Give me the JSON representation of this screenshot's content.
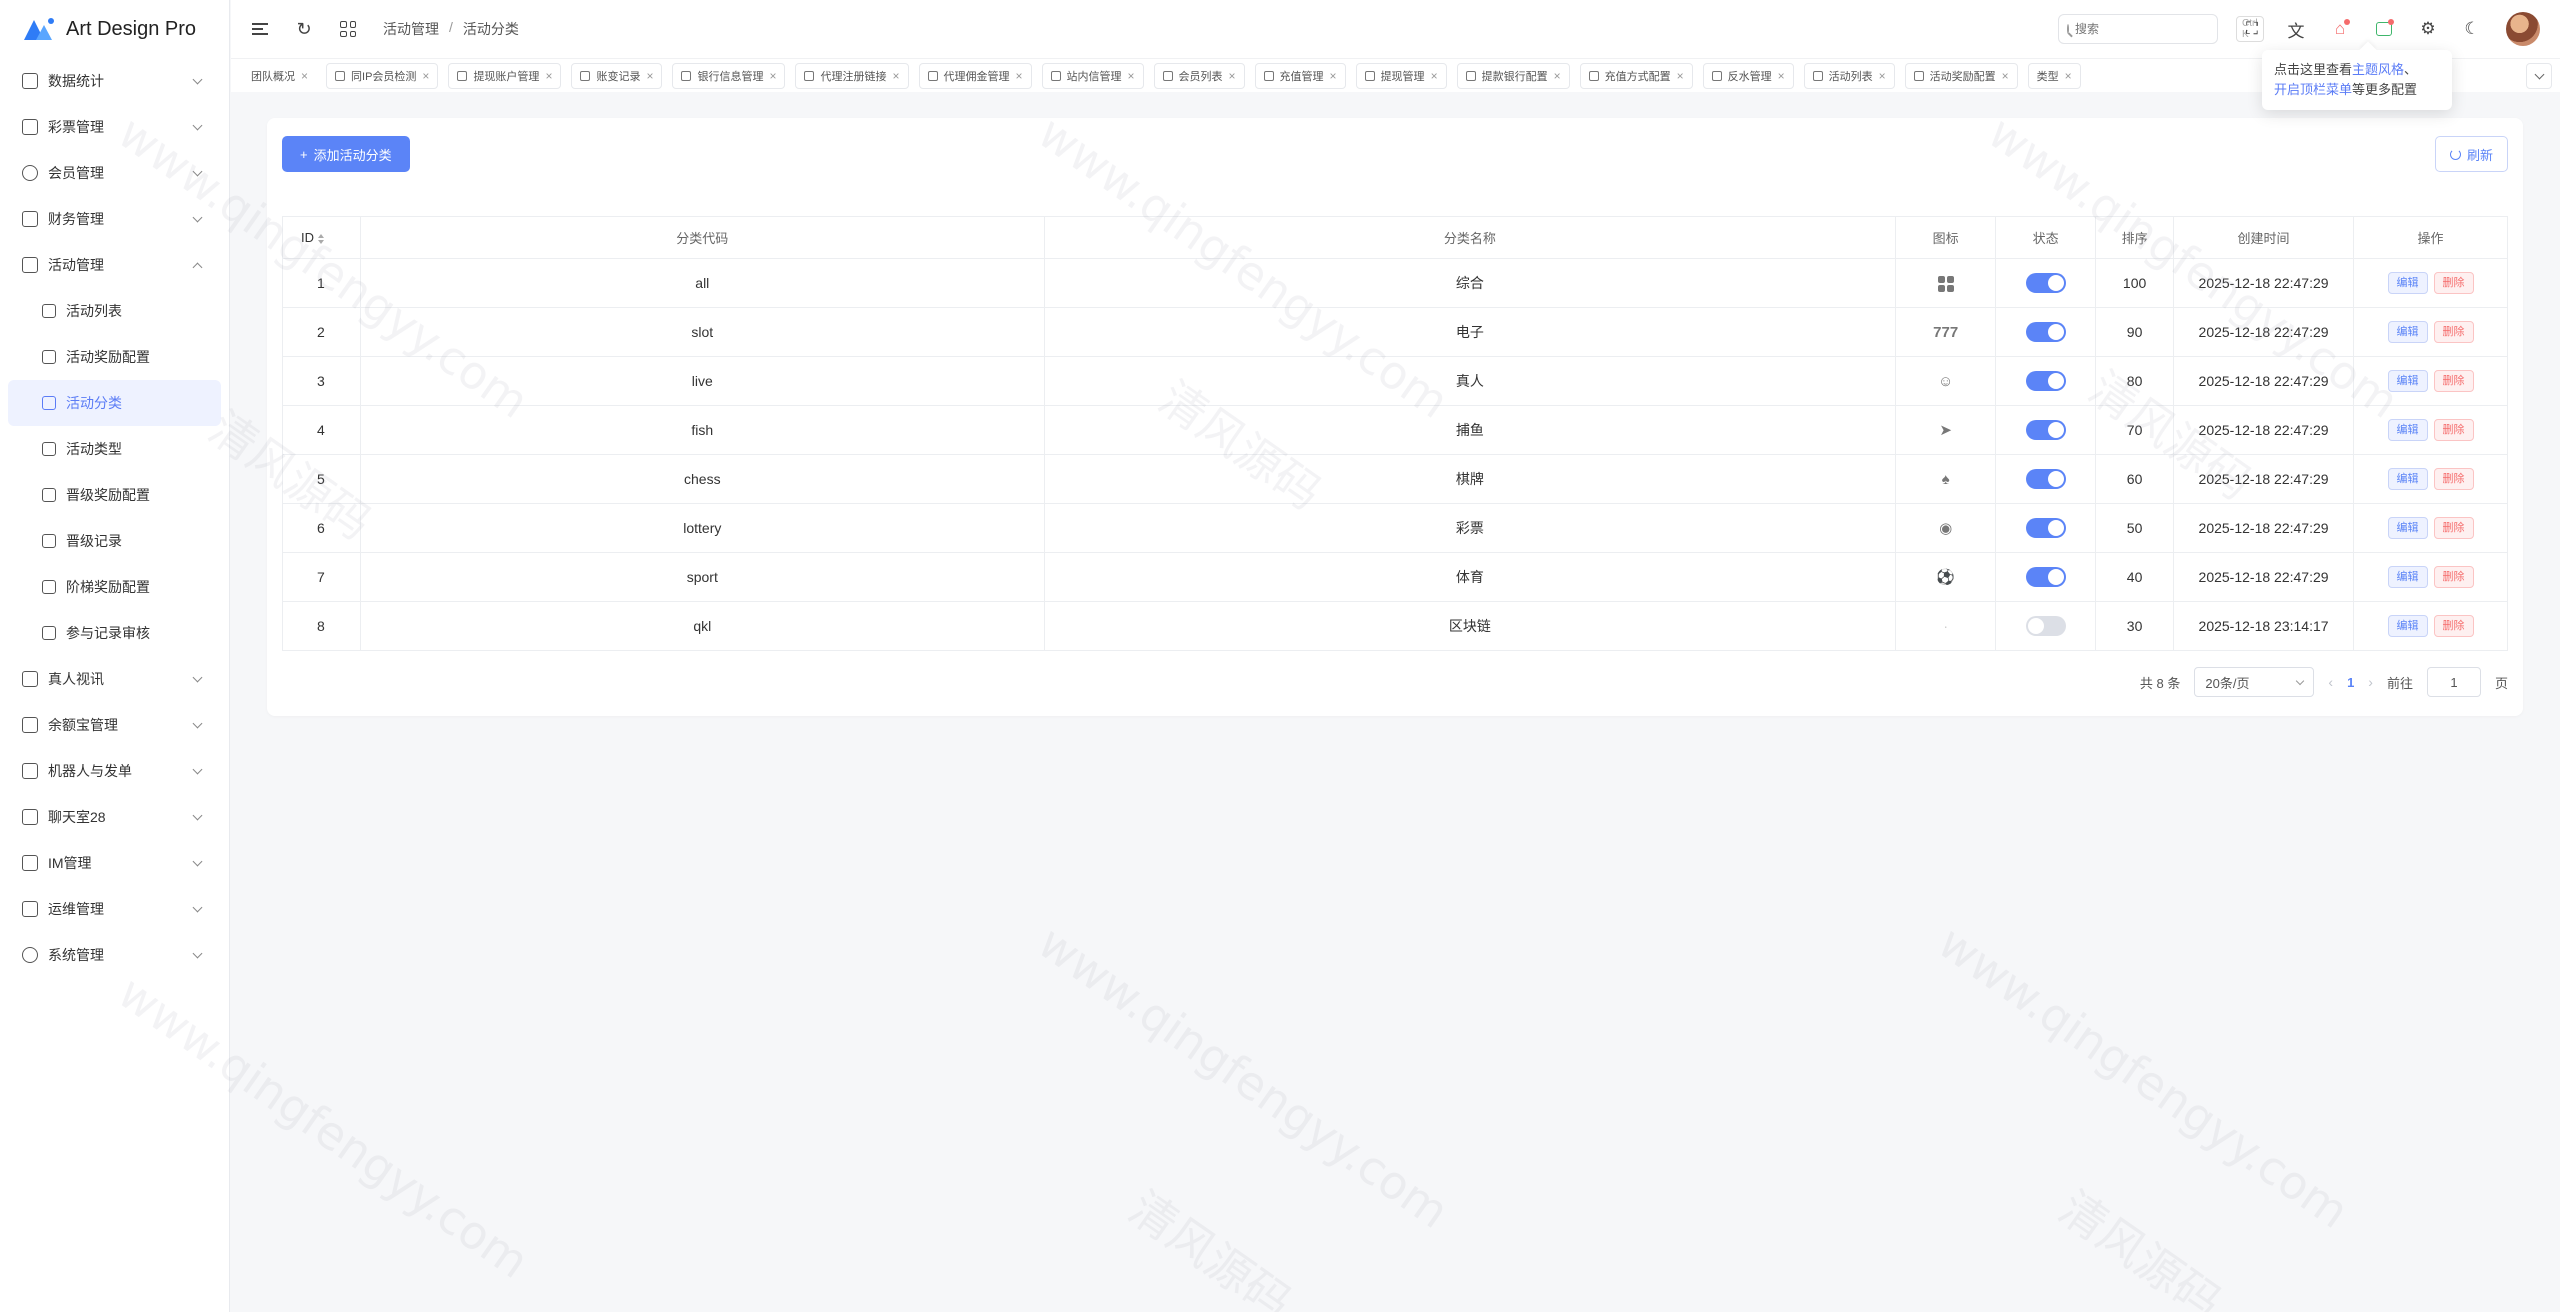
{
  "app": {
    "title": "Art Design Pro"
  },
  "sidebar": {
    "items": [
      {
        "label": "数据统计",
        "icon": "chart-icon",
        "expanded": false
      },
      {
        "label": "彩票管理",
        "icon": "ticket-icon",
        "expanded": false
      },
      {
        "label": "会员管理",
        "icon": "user-icon",
        "expanded": false
      },
      {
        "label": "财务管理",
        "icon": "wallet-icon",
        "expanded": false
      },
      {
        "label": "活动管理",
        "icon": "gift-icon",
        "expanded": true
      }
    ],
    "sub_items": [
      {
        "label": "活动列表",
        "icon": "list-icon"
      },
      {
        "label": "活动奖励配置",
        "icon": "gift-icon"
      },
      {
        "label": "活动分类",
        "icon": "category-icon",
        "active": true
      },
      {
        "label": "活动类型",
        "icon": "category-icon"
      },
      {
        "label": "晋级奖励配置",
        "icon": "crown-icon"
      },
      {
        "label": "晋级记录",
        "icon": "document-icon"
      },
      {
        "label": "阶梯奖励配置",
        "icon": "map-icon"
      },
      {
        "label": "参与记录审核",
        "icon": "file-check-icon"
      }
    ],
    "items_after": [
      {
        "label": "真人视讯",
        "icon": "video-icon"
      },
      {
        "label": "余额宝管理",
        "icon": "vault-icon"
      },
      {
        "label": "机器人与发单",
        "icon": "robot-icon"
      },
      {
        "label": "聊天室28",
        "icon": "chat-icon"
      },
      {
        "label": "IM管理",
        "icon": "message-icon"
      },
      {
        "label": "运维管理",
        "icon": "tools-icon"
      },
      {
        "label": "系统管理",
        "icon": "user-icon"
      }
    ]
  },
  "header": {
    "breadcrumb": [
      "活动管理",
      "活动分类"
    ],
    "search": {
      "placeholder": "搜索",
      "shortcut": "Ctrl K"
    }
  },
  "tabs": [
    "团队概况",
    "同IP会员检测",
    "提现账户管理",
    "账变记录",
    "银行信息管理",
    "代理注册链接",
    "代理佣金管理",
    "站内信管理",
    "会员列表",
    "充值管理",
    "提现管理",
    "提款银行配置",
    "充值方式配置",
    "反水管理",
    "活动列表",
    "活动奖励配置",
    "类型"
  ],
  "tooltip": {
    "line1_pre": "点击这里查看",
    "line1_link": "主题风格",
    "line1_post": "、",
    "line2_link": "开启顶栏菜单",
    "line2_post": "等更多配置"
  },
  "toolbar": {
    "add_label": "添加活动分类",
    "refresh_label": "刷新"
  },
  "table": {
    "columns": [
      "ID",
      "分类代码",
      "分类名称",
      "图标",
      "状态",
      "排序",
      "创建时间",
      "操作"
    ],
    "rows": [
      {
        "id": "1",
        "code": "all",
        "name": "综合",
        "icon": "grid-icon",
        "enabled": true,
        "sort": "100",
        "created": "2025-12-18 22:47:29"
      },
      {
        "id": "2",
        "code": "slot",
        "name": "电子",
        "icon": "slot-777-icon",
        "enabled": true,
        "sort": "90",
        "created": "2025-12-18 22:47:29"
      },
      {
        "id": "3",
        "code": "live",
        "name": "真人",
        "icon": "dealer-icon",
        "enabled": true,
        "sort": "80",
        "created": "2025-12-18 22:47:29"
      },
      {
        "id": "4",
        "code": "fish",
        "name": "捕鱼",
        "icon": "fish-icon",
        "enabled": true,
        "sort": "70",
        "created": "2025-12-18 22:47:29"
      },
      {
        "id": "5",
        "code": "chess",
        "name": "棋牌",
        "icon": "cards-icon",
        "enabled": true,
        "sort": "60",
        "created": "2025-12-18 22:47:29"
      },
      {
        "id": "6",
        "code": "lottery",
        "name": "彩票",
        "icon": "lottery-icon",
        "enabled": true,
        "sort": "50",
        "created": "2025-12-18 22:47:29"
      },
      {
        "id": "7",
        "code": "sport",
        "name": "体育",
        "icon": "soccer-icon",
        "enabled": true,
        "sort": "40",
        "created": "2025-12-18 22:47:29"
      },
      {
        "id": "8",
        "code": "qkl",
        "name": "区块链",
        "icon": "none",
        "enabled": false,
        "sort": "30",
        "created": "2025-12-18 23:14:17"
      }
    ],
    "actions": {
      "edit": "编辑",
      "delete": "删除"
    }
  },
  "pagination": {
    "total_text": "共 8 条",
    "page_size": "20条/页",
    "current_page": "1",
    "jump_prefix": "前往",
    "jump_value": "1",
    "jump_suffix": "页"
  },
  "watermark": {
    "text": "www.qingfengyy.com",
    "text_cn": "清风源码"
  },
  "colors": {
    "primary": "#5b84f7",
    "danger": "#f56c6c",
    "active_bg": "#eef2ff"
  }
}
